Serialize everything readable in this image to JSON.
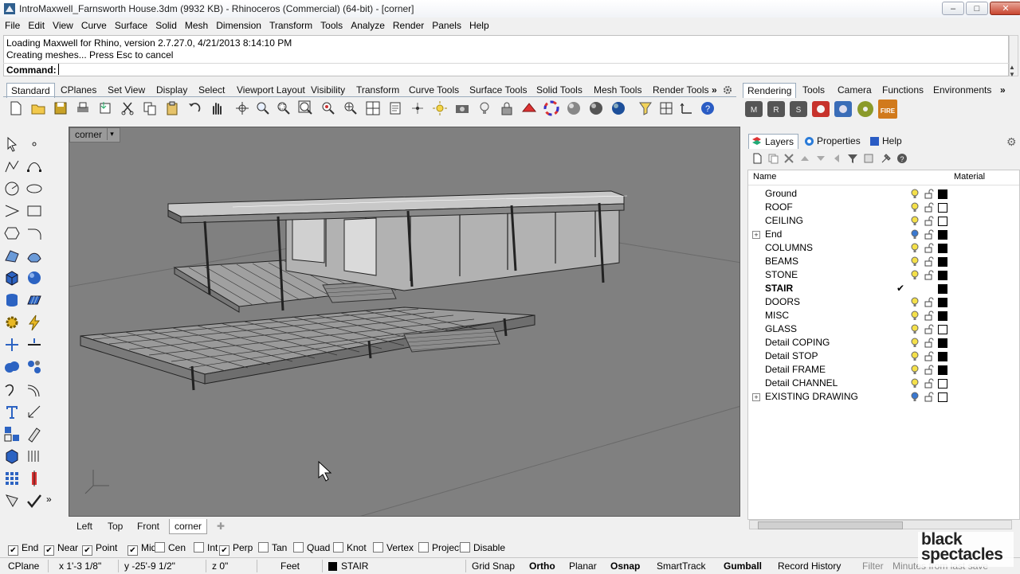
{
  "window": {
    "title": "IntroMaxwell_Farnsworth House.3dm (9932 KB) - Rhinoceros (Commercial) (64-bit) - [corner]",
    "minimize": "–",
    "maximize": "□",
    "close": "✕"
  },
  "menu": [
    "File",
    "Edit",
    "View",
    "Curve",
    "Surface",
    "Solid",
    "Mesh",
    "Dimension",
    "Transform",
    "Tools",
    "Analyze",
    "Render",
    "Panels",
    "Help"
  ],
  "command": {
    "history": [
      "Loading Maxwell for Rhino, version 2.7.27.0, 4/21/2013 8:14:10 PM",
      "Creating meshes... Press Esc to cancel"
    ],
    "prompt": "Command:",
    "value": ""
  },
  "toolbar_tabs": [
    "Standard",
    "CPlanes",
    "Set View",
    "Display",
    "Select",
    "Viewport Layout",
    "Visibility",
    "Transform",
    "Curve Tools",
    "Surface Tools",
    "Solid Tools",
    "Mesh Tools",
    "Render Tools"
  ],
  "toolbar_tabs_more": "»",
  "right_toolbar_tabs": [
    "Rendering",
    "Tools",
    "Camera",
    "Functions",
    "Environments"
  ],
  "standard_icons": [
    "new-file",
    "open-file",
    "save-file",
    "print",
    "import",
    "cut",
    "copy",
    "paste",
    "undo",
    "pan-hand",
    "rotate-view",
    "zoom-dynamic",
    "zoom-window",
    "zoom-extents",
    "zoom-selected",
    "zoom-target",
    "grid-four-views",
    "options",
    "set-point",
    "light",
    "lock",
    "material-editor",
    "color-wheel",
    "sphere-gray",
    "sphere-shaded",
    "sphere-blue",
    "selection-filter",
    "grid-snap",
    "gumball",
    "help"
  ],
  "rendering_icons": [
    "maxwell-m",
    "maxwell-r",
    "maxwell-s",
    "maxwell-red",
    "maxwell-studio",
    "maxwell-disc",
    "fire"
  ],
  "fire_label": "FIRE",
  "viewport": {
    "title": "corner",
    "dropdown": "▾",
    "tabs": [
      "Left",
      "Top",
      "Front",
      "corner"
    ],
    "active_tab": "corner",
    "add_tab": "✚"
  },
  "panel": {
    "tabs": [
      "Layers",
      "Properties",
      "Help"
    ],
    "gear": "⚙",
    "columns": {
      "name": "Name",
      "material": "Material"
    },
    "layers": [
      {
        "name": "Ground",
        "color": "#000000",
        "bulb": "on",
        "lock": "open",
        "expand": false,
        "current": false
      },
      {
        "name": "ROOF",
        "color": "#ffffff",
        "bulb": "on",
        "lock": "open",
        "expand": false,
        "current": false
      },
      {
        "name": "CEILING",
        "color": "#ffffff",
        "bulb": "on",
        "lock": "open",
        "expand": false,
        "current": false
      },
      {
        "name": "End",
        "color": "#000000",
        "bulb": "blue",
        "lock": "open",
        "expand": true,
        "current": false
      },
      {
        "name": "COLUMNS",
        "color": "#000000",
        "bulb": "on",
        "lock": "open",
        "expand": false,
        "current": false
      },
      {
        "name": "BEAMS",
        "color": "#000000",
        "bulb": "on",
        "lock": "open",
        "expand": false,
        "current": false
      },
      {
        "name": "STONE",
        "color": "#000000",
        "bulb": "on",
        "lock": "open",
        "expand": false,
        "current": false
      },
      {
        "name": "STAIR",
        "color": "#000000",
        "bulb": "none",
        "lock": "none",
        "expand": false,
        "current": true
      },
      {
        "name": "DOORS",
        "color": "#000000",
        "bulb": "on",
        "lock": "open",
        "expand": false,
        "current": false
      },
      {
        "name": "MISC",
        "color": "#000000",
        "bulb": "on",
        "lock": "open",
        "expand": false,
        "current": false
      },
      {
        "name": "GLASS",
        "color": "#ffffff",
        "bulb": "on",
        "lock": "open",
        "expand": false,
        "current": false
      },
      {
        "name": "Detail COPING",
        "color": "#000000",
        "bulb": "on",
        "lock": "open",
        "expand": false,
        "current": false
      },
      {
        "name": "Detail STOP",
        "color": "#000000",
        "bulb": "on",
        "lock": "open",
        "expand": false,
        "current": false
      },
      {
        "name": "Detail FRAME",
        "color": "#000000",
        "bulb": "on",
        "lock": "open",
        "expand": false,
        "current": false
      },
      {
        "name": "Detail CHANNEL",
        "color": "#ffffff",
        "bulb": "on",
        "lock": "open",
        "expand": false,
        "current": false
      },
      {
        "name": "EXISTING DRAWING",
        "color": "#ffffff",
        "bulb": "blue",
        "lock": "open",
        "expand": true,
        "current": false
      }
    ],
    "checkmark": "✔",
    "expand_glyph": "+"
  },
  "osnaps": [
    {
      "label": "End",
      "checked": true
    },
    {
      "label": "Near",
      "checked": true
    },
    {
      "label": "Point",
      "checked": true
    },
    {
      "label": "Mid",
      "checked": true
    },
    {
      "label": "Cen",
      "checked": false
    },
    {
      "label": "Int",
      "checked": false
    },
    {
      "label": "Perp",
      "checked": true
    },
    {
      "label": "Tan",
      "checked": false
    },
    {
      "label": "Quad",
      "checked": false
    },
    {
      "label": "Knot",
      "checked": false
    },
    {
      "label": "Vertex",
      "checked": false
    },
    {
      "label": "Project",
      "checked": false
    },
    {
      "label": "Disable",
      "checked": false
    }
  ],
  "status": {
    "cplane": "CPlane",
    "x": "x 1'-3 1/8\"",
    "y": "y -25'-9 1/2\"",
    "z": "z 0\"",
    "units": "Feet",
    "layer": "STAIR",
    "layer_color": "#000000",
    "grid_snap": "Grid Snap",
    "ortho": "Ortho",
    "planar": "Planar",
    "osnap": "Osnap",
    "smarttrack": "SmartTrack",
    "gumball": "Gumball",
    "record_history": "Record History",
    "filter": "Filter",
    "minutes": "Minutes from last save"
  },
  "watermark": {
    "line1": "black",
    "line2": "spectacles"
  }
}
